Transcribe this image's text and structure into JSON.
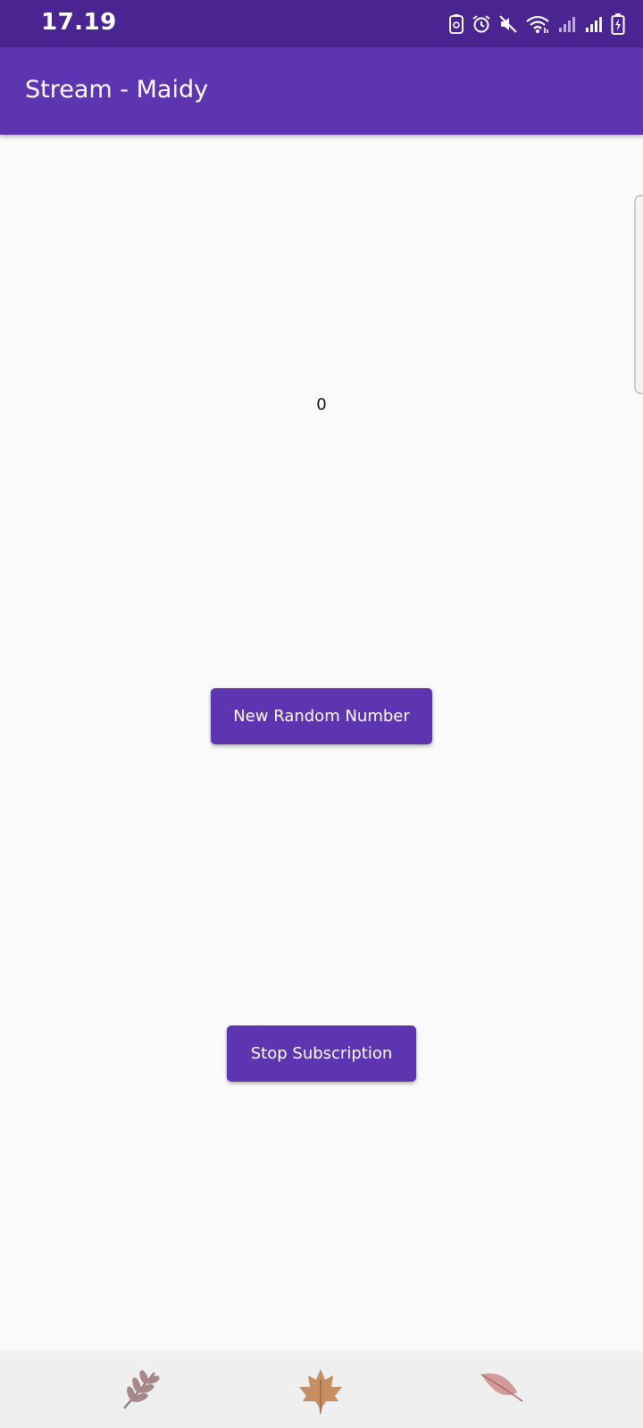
{
  "status_bar": {
    "time": "17.19",
    "icons": [
      "screenshot-icon",
      "alarm-icon",
      "mute-icon",
      "wifi-icon",
      "signal-icon-1",
      "signal-icon-2",
      "battery-charging-icon"
    ]
  },
  "app_bar": {
    "title": "Stream - Maidy"
  },
  "main": {
    "counter_value": "0",
    "new_random_button_label": "New Random Number",
    "stop_subscription_button_label": "Stop Subscription"
  },
  "bottom_bar": {
    "icons": [
      "fern-leaf-icon",
      "maple-leaf-icon",
      "oval-leaf-icon"
    ]
  },
  "colors": {
    "status_bar": "#4a2591",
    "app_bar": "#5e35b1",
    "button": "#5e35b1",
    "background": "#fafafa"
  }
}
